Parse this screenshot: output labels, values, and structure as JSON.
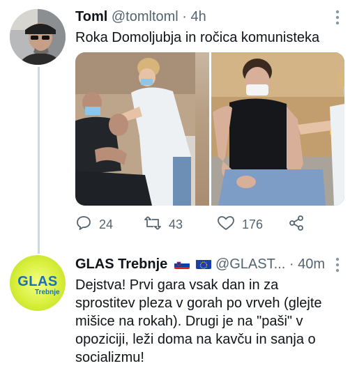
{
  "tweet1": {
    "name": "Toml",
    "handle": "@tomltoml",
    "separator": "·",
    "time": "4h",
    "text": "Roka Domoljubja in ročica komunisteka",
    "media_alt_left": "vaccination-photo-man",
    "media_alt_right": "vaccination-photo-young-man",
    "replies": "24",
    "retweets": "43",
    "likes": "176"
  },
  "tweet2": {
    "name": "GLAS Trebnje",
    "handle": "@GLAST...",
    "separator": "·",
    "time": "40m",
    "avatar_text": "GLAS",
    "avatar_subtext": "Trebnje",
    "text_lines": [
      "Dejstva! Prvi gara vsak dan in za",
      "sprostitev pleza v gorah po vrveh (glejte",
      "mišice na rokah). Drugi je na \"paši\" v",
      "opoziciji, leži doma na kavču in sanja o",
      "socializmu!"
    ]
  },
  "icons": {
    "reply": "reply-icon",
    "retweet": "retweet-icon",
    "like": "heart-icon",
    "share": "share-icon",
    "more": "more-vertical-icon"
  },
  "colors": {
    "text": "#0f1419",
    "secondary": "#536471",
    "thread_line": "#cfd9de"
  }
}
